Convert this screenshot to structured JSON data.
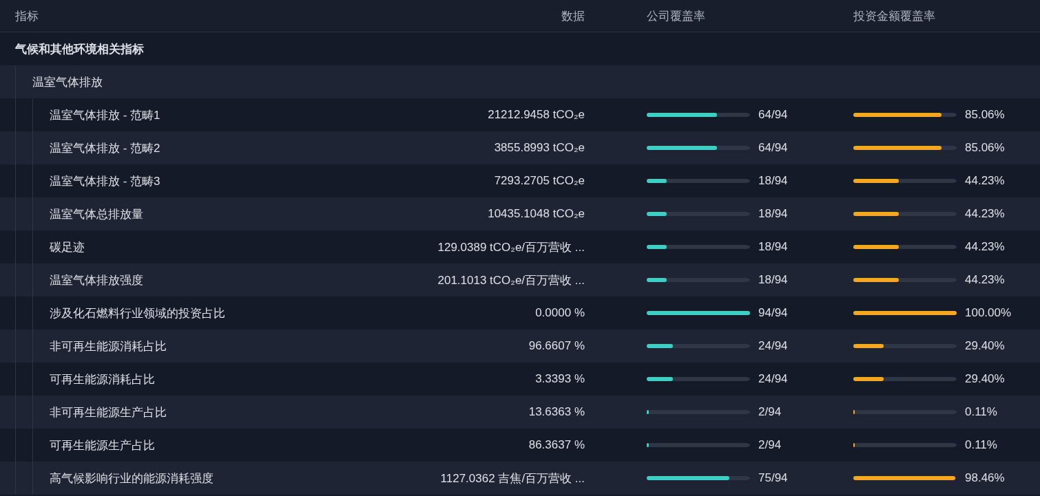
{
  "table": {
    "columns": [
      "指标",
      "数据",
      "公司覆盖率",
      "投资金额覆盖率"
    ],
    "rows": [
      {
        "kind": "category",
        "label": "气候和其他环境相关指标",
        "children": [
          {
            "kind": "group",
            "label": "温室气体排放",
            "children": [
              {
                "name": "温室气体排放 - 范畴1",
                "value": "21212.9458 tCO₂e",
                "company": {
                  "level": 0.68,
                  "text": "64/94"
                },
                "investment": {
                  "level": 0.8506,
                  "text": "85.06%"
                }
              },
              {
                "name": "温室气体排放 - 范畴2",
                "value": "3855.8993 tCO₂e",
                "company": {
                  "level": 0.68,
                  "text": "64/94"
                },
                "investment": {
                  "level": 0.8506,
                  "text": "85.06%"
                }
              },
              {
                "name": "温室气体排放 - 范畴3",
                "value": "7293.2705 tCO₂e",
                "company": {
                  "level": 0.19,
                  "text": "18/94"
                },
                "investment": {
                  "level": 0.4423,
                  "text": "44.23%"
                }
              },
              {
                "name": "温室气体总排放量",
                "value": "10435.1048 tCO₂e",
                "company": {
                  "level": 0.19,
                  "text": "18/94"
                },
                "investment": {
                  "level": 0.4423,
                  "text": "44.23%"
                }
              },
              {
                "name": "碳足迹",
                "value": "129.0389 tCO₂e/百万营收 ...",
                "company": {
                  "level": 0.19,
                  "text": "18/94"
                },
                "investment": {
                  "level": 0.4423,
                  "text": "44.23%"
                }
              },
              {
                "name": "温室气体排放强度",
                "value": "201.1013 tCO₂e/百万营收 ...",
                "company": {
                  "level": 0.19,
                  "text": "18/94"
                },
                "investment": {
                  "level": 0.4423,
                  "text": "44.23%"
                }
              },
              {
                "name": "涉及化石燃料行业领域的投资占比",
                "value": "0.0000 %",
                "company": {
                  "level": 1,
                  "text": "94/94"
                },
                "investment": {
                  "level": 1,
                  "text": "100.00%"
                }
              },
              {
                "name": "非可再生能源消耗占比",
                "value": "96.6607 %",
                "company": {
                  "level": 0.255,
                  "text": "24/94"
                },
                "investment": {
                  "level": 0.294,
                  "text": "29.40%"
                }
              },
              {
                "name": "可再生能源消耗占比",
                "value": "3.3393 %",
                "company": {
                  "level": 0.255,
                  "text": "24/94"
                },
                "investment": {
                  "level": 0.294,
                  "text": "29.40%"
                }
              },
              {
                "name": "非可再生能源生产占比",
                "value": "13.6363 %",
                "company": {
                  "level": 0.02,
                  "text": "2/94"
                },
                "investment": {
                  "level": 0.0011,
                  "text": "0.11%"
                }
              },
              {
                "name": "可再生能源生产占比",
                "value": "86.3637 %",
                "company": {
                  "level": 0.02,
                  "text": "2/94"
                },
                "investment": {
                  "level": 0.0011,
                  "text": "0.11%"
                }
              },
              {
                "name": "高气候影响行业的能源消耗强度",
                "value": "1127.0362 吉焦/百万营收 ...",
                "company": {
                  "level": 0.8,
                  "text": "75/94"
                },
                "investment": {
                  "level": 0.9846,
                  "text": "98.46%"
                }
              }
            ]
          }
        ]
      }
    ]
  }
}
